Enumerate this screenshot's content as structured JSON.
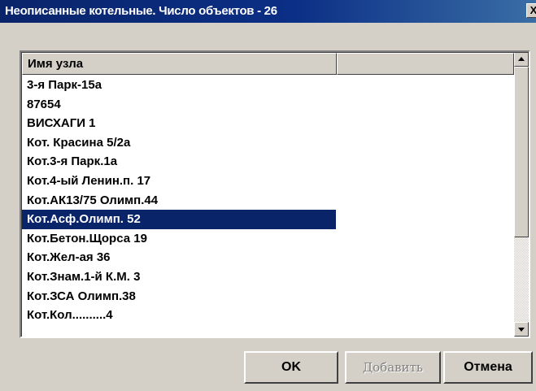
{
  "window": {
    "title": "Неописанные котельные. Число объектов - 26",
    "close_glyph": "X"
  },
  "list": {
    "columns": [
      "Имя узла",
      ""
    ],
    "rows": [
      "3-я Парк-15а",
      "87654",
      "ВИСХАГИ 1",
      "Кот. Красина 5/2а",
      "Кот.3-я Парк.1а",
      "Кот.4-ый Ленин.п. 17",
      "Кот.АК13/75 Олимп.44",
      "Кот.Асф.Олимп. 52",
      "Кот.Бетон.Щорса 19",
      "Кот.Жел-ая 36",
      "Кот.Знам.1-й К.М. 3",
      "Кот.ЗСА Олимп.38",
      "Кот.Кол..........4"
    ],
    "selected_index": 7
  },
  "buttons": {
    "ok": "OK",
    "add": "Добавить",
    "cancel": "Отмена"
  },
  "colors": {
    "selection": "#0a246a",
    "face": "#d4d0c8"
  }
}
